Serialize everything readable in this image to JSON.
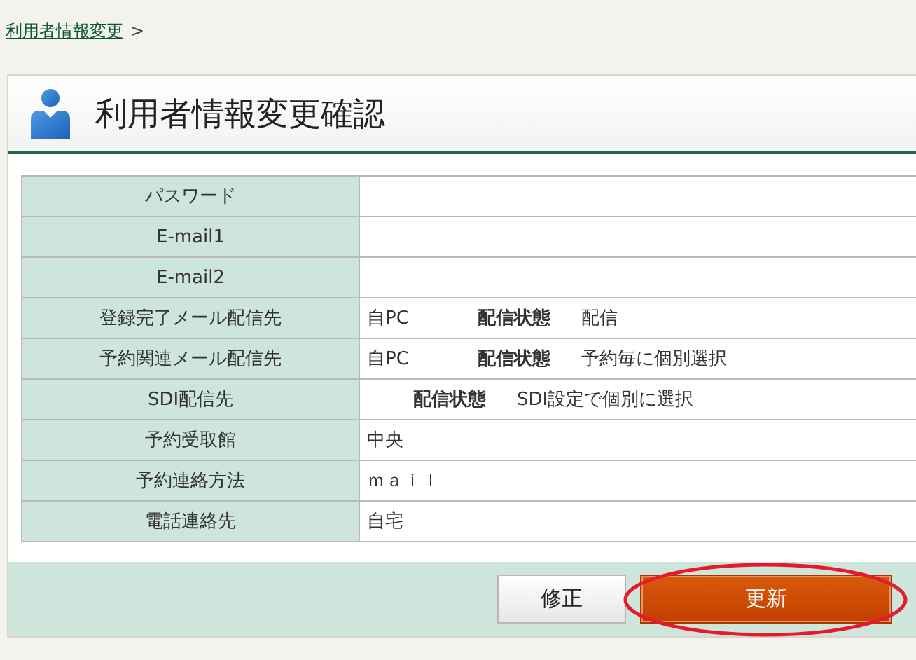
{
  "breadcrumb": {
    "link": "利用者情報変更",
    "separator": ">"
  },
  "page_title": "利用者情報変更確認",
  "rows": [
    {
      "label": "パスワード"
    },
    {
      "label": "E-mail1"
    },
    {
      "label": "E-mail2"
    },
    {
      "label": "登録完了メール配信先",
      "value": "自PC",
      "status_label": "配信状態",
      "status_value": "配信"
    },
    {
      "label": "予約関連メール配信先",
      "value": "自PC",
      "status_label": "配信状態",
      "status_value": "予約毎に個別選択"
    },
    {
      "label": "SDI配信先",
      "status_label": "配信状態",
      "status_value": "SDI設定で個別に選択"
    },
    {
      "label": "予約受取館",
      "value": "中央"
    },
    {
      "label": "予約連絡方法",
      "value": "ｍａｉｌ"
    },
    {
      "label": "電話連絡先",
      "value": "自宅"
    }
  ],
  "buttons": [
    {
      "label": "修正",
      "kind": "secondary",
      "highlighted": false
    },
    {
      "label": "更新",
      "kind": "primary",
      "highlighted": true
    }
  ]
}
